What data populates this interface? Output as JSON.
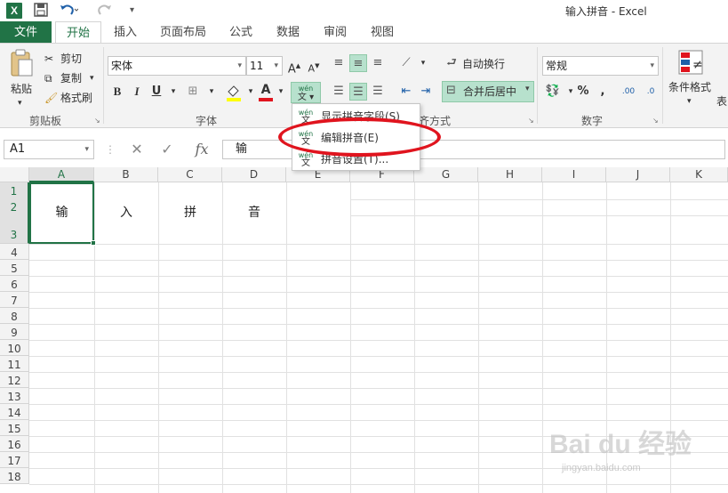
{
  "window": {
    "title": "输入拼音 - Excel",
    "app_icon": "X"
  },
  "quick_access": {
    "save_icon": "save-icon",
    "undo_icon": "undo-icon",
    "redo_icon": "redo-icon",
    "customize_icon": "customize-icon"
  },
  "tabs": [
    {
      "label": "文件"
    },
    {
      "label": "开始"
    },
    {
      "label": "插入"
    },
    {
      "label": "页面布局"
    },
    {
      "label": "公式"
    },
    {
      "label": "数据"
    },
    {
      "label": "审阅"
    },
    {
      "label": "视图"
    }
  ],
  "ribbon": {
    "clipboard": {
      "paste": "粘贴",
      "cut": "剪切",
      "copy": "复制",
      "format_painter": "格式刷",
      "group": "剪贴板"
    },
    "font": {
      "name": "宋体",
      "size": "11",
      "group": "字体",
      "bold": "B",
      "italic": "I",
      "underline": "U",
      "grow": "A",
      "shrink": "A",
      "font_color": "A",
      "phonetic": "wén"
    },
    "alignment": {
      "wrap": "自动换行",
      "merge": "合并后居中",
      "group_partial": "齐方式"
    },
    "number": {
      "format": "常规",
      "group": "数字",
      "percent": "%",
      "comma": ",",
      "inc_decimal": ".00",
      "dec_decimal": ".0"
    },
    "styles": {
      "conditional": "条件格式",
      "table_partial": "表"
    }
  },
  "formula_bar": {
    "name_box": "A1",
    "fx": "fx",
    "content": "输"
  },
  "columns": [
    "A",
    "B",
    "C",
    "D",
    "E",
    "F",
    "G",
    "H",
    "I",
    "J",
    "K"
  ],
  "rows": [
    "1",
    "2",
    "3",
    "4",
    "5",
    "6",
    "7",
    "8",
    "9",
    "10",
    "11",
    "12",
    "13",
    "14",
    "15",
    "16",
    "17",
    "18"
  ],
  "cells": {
    "A1": "输",
    "B1": "入",
    "C1": "拼",
    "D1": "音"
  },
  "phonetic_menu": {
    "items": [
      {
        "label": "显示拼音字段(S)",
        "icon": "wén"
      },
      {
        "label": "编辑拼音(E)",
        "icon": "wén"
      },
      {
        "label": "拼音设置(T)...",
        "icon": "wén"
      }
    ]
  },
  "watermark": {
    "main": "Bai du 经验",
    "sub": "jingyan.baidu.com"
  },
  "colors": {
    "excel_green": "#217346",
    "highlight_red": "#e0141e",
    "ribbon_bg": "#f3f3f3"
  }
}
